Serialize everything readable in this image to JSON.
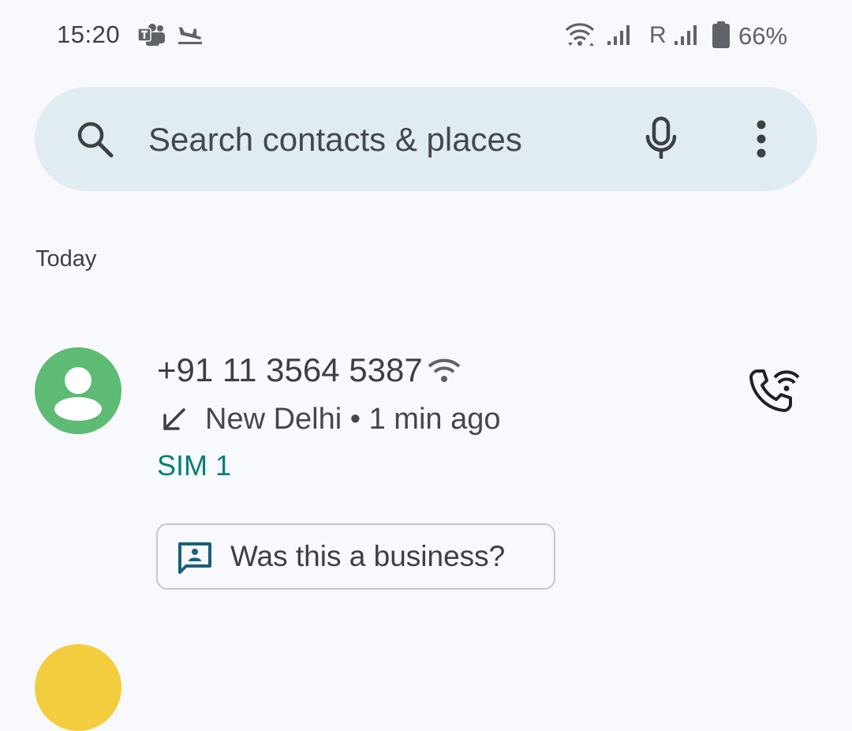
{
  "status_bar": {
    "time": "15:20",
    "network_indicator": "R",
    "battery_percent": "66%",
    "icons": [
      "teams-icon",
      "flight-arrival-icon",
      "wifi-icon",
      "signal-icon",
      "signal-icon",
      "battery-icon"
    ]
  },
  "search": {
    "placeholder": "Search contacts & places",
    "icons": [
      "search-icon",
      "mic-icon",
      "more-vert-icon"
    ]
  },
  "section": {
    "title": "Today"
  },
  "calls": [
    {
      "number": "+91 11 3564 5387",
      "location": "New Delhi",
      "separator": "•",
      "time_ago": "1 min ago",
      "sim": "SIM 1",
      "direction_icon": "incoming-call-arrow-icon",
      "badge_icon": "wifi-calling-icon",
      "action_icon": "wifi-call-icon",
      "chip_label": "Was this a business?",
      "chip_icon": "business-feedback-icon",
      "avatar_color": "#5dbb74"
    }
  ],
  "colors": {
    "background": "#f8f9fc",
    "search_bar": "#e1ecf2",
    "accent_teal": "#0a7c7c",
    "next_avatar": "#f4cd3f"
  }
}
